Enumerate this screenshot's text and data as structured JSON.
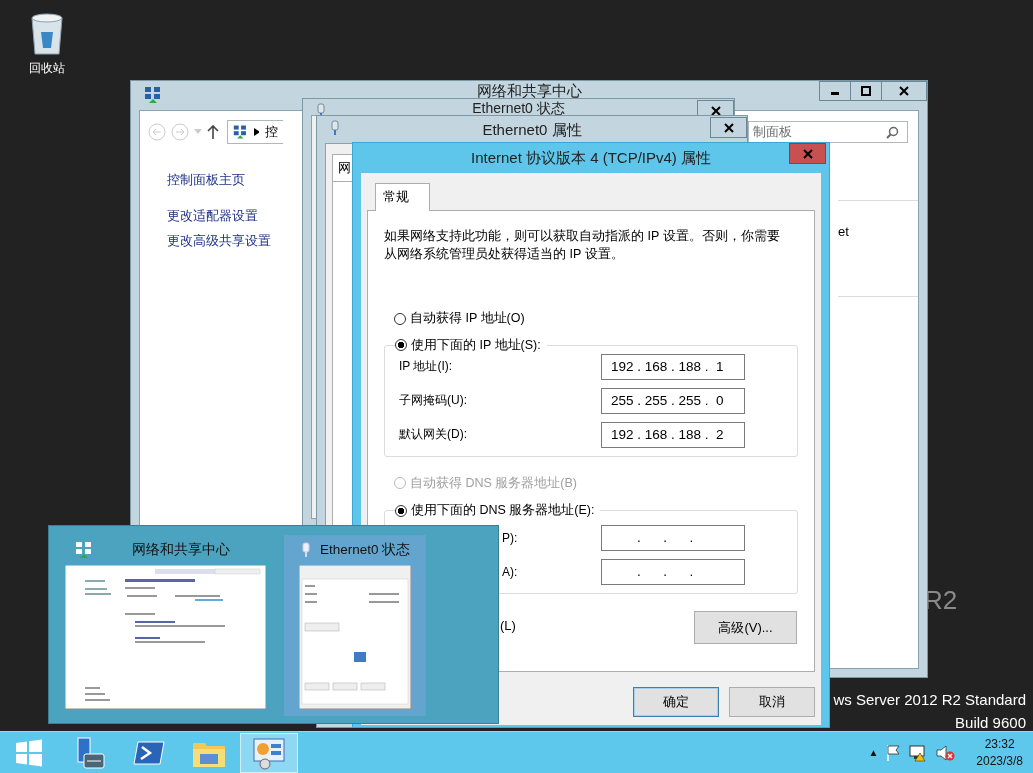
{
  "desktop": {
    "icons": [
      {
        "label": "回收站"
      }
    ],
    "branding": {
      "watermark": "R2",
      "edition": "ws Server 2012 R2 Standard",
      "build": "Build 9600"
    }
  },
  "main_window": {
    "title": "网络和共享中心",
    "address": "控",
    "search": "制面板",
    "links": [
      "控制面板主页",
      "更改适配器设置",
      "更改高级共享设置"
    ],
    "fragment": "et"
  },
  "status_window": {
    "title": "Ethernet0 状态"
  },
  "properties_window": {
    "title": "Ethernet0 属性",
    "tab": "网"
  },
  "ipv4_dialog": {
    "title": "Internet 协议版本 4 (TCP/IPv4) 属性",
    "tabs": [
      {
        "label": "常规",
        "selected": true
      }
    ],
    "description": "如果网络支持此功能，则可以获取自动指派的 IP 设置。否则，你需要从网络系统管理员处获得适当的 IP 设置。",
    "ip_options": [
      {
        "label": "自动获得 IP 地址(O)",
        "selected": false,
        "disabled": false
      },
      {
        "label": "使用下面的 IP 地址(S):",
        "selected": true,
        "disabled": false
      }
    ],
    "ip_fields": [
      {
        "label": "IP 地址(I):",
        "value": "192 . 168 . 188 .  1"
      },
      {
        "label": "子网掩码(U):",
        "value": "255 . 255 . 255 .  0"
      },
      {
        "label": "默认网关(D):",
        "value": "192 . 168 . 188 .  2"
      }
    ],
    "dns_options": [
      {
        "label": "自动获得 DNS 服务器地址(B)",
        "selected": false,
        "disabled": true
      },
      {
        "label": "使用下面的 DNS 服务器地址(E):",
        "selected": true,
        "disabled": false
      }
    ],
    "dns_fields": [
      {
        "label": "P):",
        "value": ".      .      ."
      },
      {
        "label": "A):",
        "value": ".      .      ."
      }
    ],
    "validate_label": "(L)",
    "advanced_button": "高级(V)...",
    "buttons": [
      {
        "label": "确定",
        "default": true
      },
      {
        "label": "取消",
        "default": false
      }
    ]
  },
  "taskbar_preview": {
    "items": [
      {
        "title": "网络和共享中心",
        "kind": "network",
        "selected": false
      },
      {
        "title": "Ethernet0 状态",
        "kind": "ethernet",
        "selected": true
      }
    ]
  },
  "taskbar": {
    "apps": [
      {
        "kind": "start",
        "selected": false
      },
      {
        "kind": "server-manager",
        "selected": false
      },
      {
        "kind": "powershell",
        "selected": false
      },
      {
        "kind": "explorer",
        "selected": false
      },
      {
        "kind": "control-panel",
        "selected": true
      }
    ],
    "tray_toggle": "▲",
    "time": "23:32",
    "date": "2023/3/8"
  }
}
